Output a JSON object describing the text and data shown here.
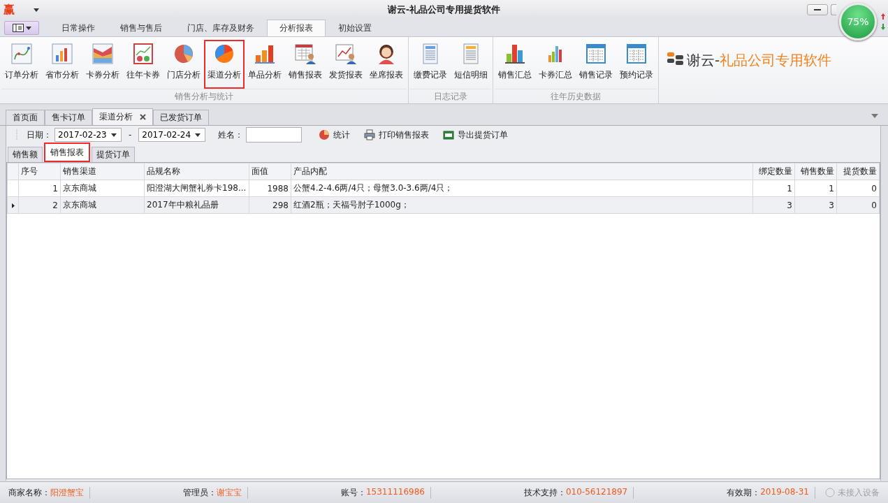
{
  "window": {
    "app_icon": "赢",
    "title": "谢云-礼品公司专用提货软件"
  },
  "speed_widget": {
    "percent": "75%"
  },
  "ribbon": {
    "tabs": [
      {
        "label": "日常操作",
        "selected": false
      },
      {
        "label": "销售与售后",
        "selected": false
      },
      {
        "label": "门店、库存及财务",
        "selected": false
      },
      {
        "label": "分析报表",
        "selected": true
      },
      {
        "label": "初始设置",
        "selected": false
      }
    ],
    "groups": [
      {
        "caption": "销售分析与统计",
        "buttons": [
          {
            "label": "订单分析",
            "highlighted": false
          },
          {
            "label": "省市分析",
            "highlighted": false
          },
          {
            "label": "卡券分析",
            "highlighted": false
          },
          {
            "label": "往年卡券",
            "highlighted": false
          },
          {
            "label": "门店分析",
            "highlighted": false
          },
          {
            "label": "渠道分析",
            "highlighted": true
          },
          {
            "label": "单品分析",
            "highlighted": false
          },
          {
            "label": "销售报表",
            "highlighted": false
          },
          {
            "label": "发货报表",
            "highlighted": false
          },
          {
            "label": "坐席报表",
            "highlighted": false
          }
        ]
      },
      {
        "caption": "日志记录",
        "buttons": [
          {
            "label": "缴费记录",
            "highlighted": false
          },
          {
            "label": "短信明细",
            "highlighted": false
          }
        ]
      },
      {
        "caption": "往年历史数据",
        "buttons": [
          {
            "label": "销售汇总",
            "highlighted": false
          },
          {
            "label": "卡券汇总",
            "highlighted": false
          },
          {
            "label": "销售记录",
            "highlighted": false
          },
          {
            "label": "预约记录",
            "highlighted": false
          }
        ]
      }
    ],
    "brand": {
      "prefix": "谢云-",
      "name": "礼品公司专用软件"
    }
  },
  "doc_tabs": [
    {
      "label": "首页面",
      "selected": false,
      "closable": false
    },
    {
      "label": "售卡订单",
      "selected": false,
      "closable": false
    },
    {
      "label": "渠道分析",
      "selected": true,
      "closable": true
    },
    {
      "label": "已发货订单",
      "selected": false,
      "closable": false
    }
  ],
  "toolbar": {
    "date_label": "日期：",
    "date_from": "2017-02-23",
    "separator": "-",
    "date_to": "2017-02-24",
    "name_label": "姓名：",
    "actions": [
      "统计",
      "打印销售报表",
      "导出提货订单"
    ]
  },
  "sub_tabs": [
    {
      "label": "销售额",
      "selected": false,
      "highlighted": false
    },
    {
      "label": "销售报表",
      "selected": true,
      "highlighted": true
    },
    {
      "label": "提货订单",
      "selected": false,
      "highlighted": false
    }
  ],
  "table": {
    "columns": [
      {
        "label": "序号",
        "numeric": false
      },
      {
        "label": "销售渠道",
        "numeric": false
      },
      {
        "label": "品规名称",
        "numeric": false
      },
      {
        "label": "面值",
        "numeric": false
      },
      {
        "label": "产品内配",
        "numeric": false
      },
      {
        "label": "绑定数量",
        "numeric": true
      },
      {
        "label": "销售数量",
        "numeric": true
      },
      {
        "label": "提货数量",
        "numeric": true
      }
    ],
    "rows": [
      {
        "selected": false,
        "cells": [
          "1",
          "京东商城",
          "阳澄湖大闸蟹礼券卡198...",
          "1988",
          "公蟹4.2-4.6两/4只；母蟹3.0-3.6两/4只；",
          "1",
          "1",
          "0"
        ]
      },
      {
        "selected": true,
        "cells": [
          "2",
          "京东商城",
          "2017年中粮礼品册",
          "298",
          "红酒2瓶；天福号肘子1000g；",
          "3",
          "3",
          "0"
        ]
      }
    ]
  },
  "status_bar": {
    "fields": [
      {
        "label": "商家名称：",
        "value": "阳澄蟹宝"
      },
      {
        "label": "管理员：",
        "value": "谢宝宝"
      },
      {
        "label": "账号：",
        "value": "15311116986"
      },
      {
        "label": "技术支持：",
        "value": "010-56121897"
      },
      {
        "label": "有效期：",
        "value": "2019-08-31"
      }
    ],
    "device": {
      "label": "未接入设备",
      "connected": false
    }
  }
}
